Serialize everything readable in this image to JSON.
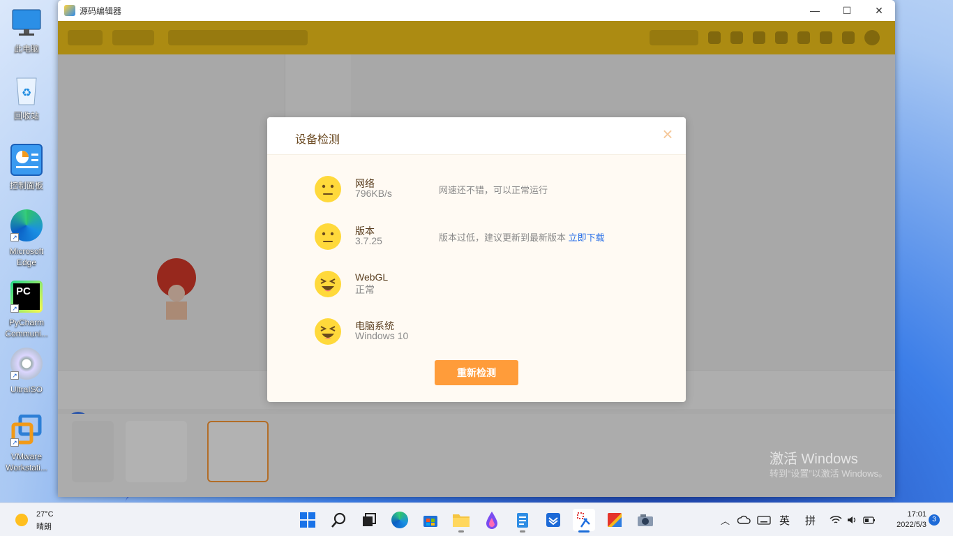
{
  "desktop": {
    "icons": [
      {
        "label": "此电脑"
      },
      {
        "label": "回收站"
      },
      {
        "label": "控制面板"
      },
      {
        "label": "Microsoft Edge"
      },
      {
        "label": "PyCharm Communi..."
      },
      {
        "label": "UltraISO"
      },
      {
        "label": "VMware Workstati..."
      }
    ],
    "watermark": {
      "line1": "激活 Windows",
      "line2": "转到“设置”以激活 Windows。"
    }
  },
  "window": {
    "title": "源码编辑器",
    "controls": {
      "minimize": "—",
      "maximize": "☐",
      "close": "✕"
    }
  },
  "dialog": {
    "title": "设备检测",
    "close": "×",
    "rows": [
      {
        "name": "网络",
        "value": "796KB/s",
        "message": "网速还不错，可以正常运行",
        "face": "neutral"
      },
      {
        "name": "版本",
        "value": "3.7.25",
        "message": "版本过低，建议更新到最新版本",
        "link": "立即下载",
        "face": "neutral"
      },
      {
        "name": "WebGL",
        "value": "正常",
        "message": "",
        "face": "laugh"
      },
      {
        "name": "电脑系统",
        "value": "Windows 10",
        "message": "",
        "face": "laugh"
      }
    ],
    "recheck_label": "重新检测"
  },
  "taskbar": {
    "weather": {
      "temp": "27°C",
      "condition": "晴朗"
    },
    "apps": [
      "start-icon",
      "search-icon",
      "task-view-icon",
      "edge-icon",
      "store-icon",
      "file-explorer-icon",
      "paint-icon",
      "notepad-icon",
      "mail-icon",
      "code-editor-icon",
      "photos-icon",
      "camera-icon"
    ],
    "tray": {
      "lang": "英",
      "ime": "拼"
    },
    "clock": {
      "time": "17:01",
      "date": "2022/5/3"
    },
    "notifications": "3"
  },
  "colors": {
    "toolbar": "#f7c81a",
    "accent_button": "#ff9c3a",
    "link": "#2f73e8",
    "face": "#ffd93b"
  }
}
